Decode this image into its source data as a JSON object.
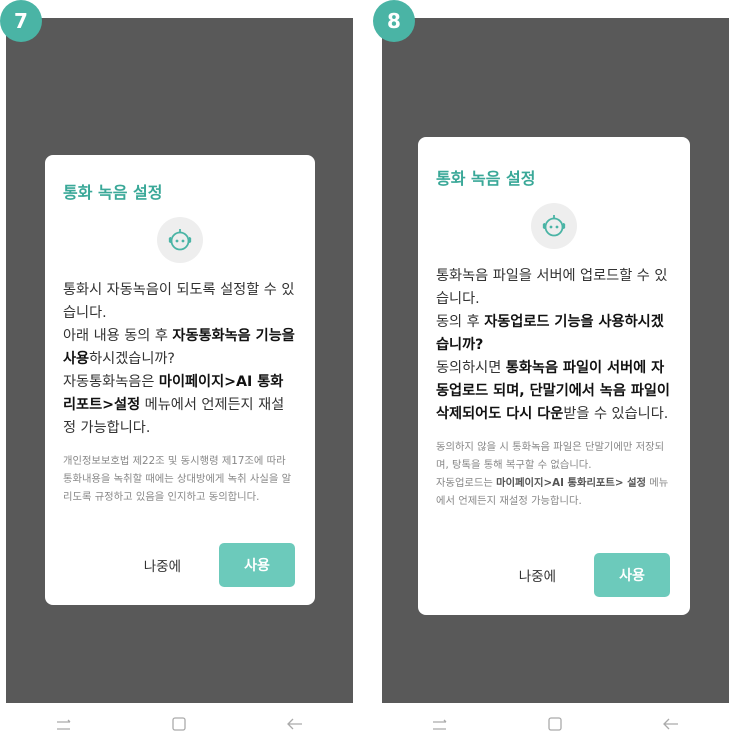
{
  "panels": [
    {
      "step": "7",
      "title": "통화 녹음 설정",
      "main_html": "통화시 자동녹음이 되도록 설정할 수 있습니다.<br>아래 내용 동의 후 <b>자동통화녹음 기능을 사용</b>하시겠습니까?<br>자동통화녹음은 <b>마이페이지&gt;AI 통화 리포트&gt;설정</b> 메뉴에서 언제든지 재설정 가능합니다.",
      "note_html": "개인정보보호법 제22조 및 동시행령 제17조에 따라 통화내용을 녹취할 때에는 상대방에게 녹취 사실을 알리도록 규정하고 있음을 인지하고 동의합니다.",
      "later_label": "나중에",
      "use_label": "사용"
    },
    {
      "step": "8",
      "title": "통화 녹음 설정",
      "main_html": "통화녹음 파일을 서버에 업로드할 수 있습니다.<br>동의 후 <b>자동업로드 기능을 사용하시겠습니까?</b><br>동의하시면 <b>통화녹음 파일이 서버에 자동업로드 되며, 단말기에서 녹음 파일이 삭제되어도 다시 다운</b>받을 수 있습니다.",
      "note_html": "동의하지 않을 시 통화녹음 파일은 단말기에만 저장되며, 탕톡을 통해 복구할 수 없습니다.<br>자동업로드는 <b>마이페이지&gt;AI 통화리포트&gt; 설정</b> 메뉴에서 언제든지 재설정 가능합니다.",
      "later_label": "나중에",
      "use_label": "사용"
    }
  ],
  "colors": {
    "accent": "#4ab4a5",
    "button": "#6ccabb",
    "overlay": "#595959"
  },
  "icons": [
    "robot-icon",
    "recent-apps-icon",
    "home-icon",
    "back-icon"
  ]
}
